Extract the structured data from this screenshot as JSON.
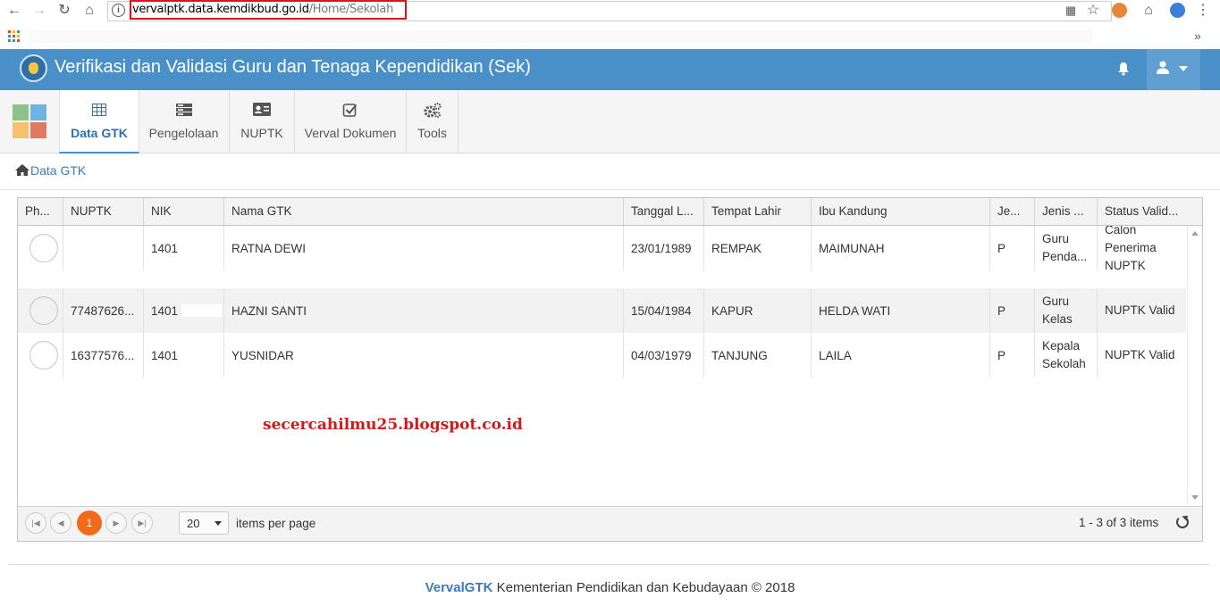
{
  "browser": {
    "url_host": "vervalptk.data.kemdikbud.go.id",
    "url_path": "/Home/Sekolah"
  },
  "header": {
    "title": "Verifikasi dan Validasi Guru dan Tenaga Kependidikan (Sek)"
  },
  "toolbar": {
    "items": [
      {
        "label": "Data GTK",
        "icon": "table-icon",
        "active": true
      },
      {
        "label": "Pengelolaan",
        "icon": "list-icon"
      },
      {
        "label": "NUPTK",
        "icon": "id-card-icon"
      },
      {
        "label": "Verval Dokumen",
        "icon": "check-square-icon"
      },
      {
        "label": "Tools",
        "icon": "cogs-icon"
      }
    ]
  },
  "breadcrumb": {
    "label": "Data GTK"
  },
  "table": {
    "columns": [
      "Ph...",
      "NUPTK",
      "NIK",
      "Nama GTK",
      "Tanggal L...",
      "Tempat Lahir",
      "Ibu Kandung",
      "Je...",
      "Jenis ...",
      "Status Valid..."
    ],
    "rows": [
      {
        "nuptk": "",
        "nik": "1401",
        "nama": "RATNA DEWI",
        "tgl": "23/01/1989",
        "tempat": "REMPAK",
        "ibu": "MAIMUNAH",
        "jk": "P",
        "jenis": "Guru Penda...",
        "status": "Calon Penerima NUPTK"
      },
      {
        "nuptk": "77487626...",
        "nik": "1401",
        "nama": "HAZNI SANTI",
        "tgl": "15/04/1984",
        "tempat": "KAPUR",
        "ibu": "HELDA WATI",
        "jk": "P",
        "jenis": "Guru Kelas",
        "status": "NUPTK Valid"
      },
      {
        "nuptk": "16377576...",
        "nik": "1401",
        "nama": "YUSNIDAR",
        "tgl": "04/03/1979",
        "tempat": "TANJUNG",
        "ibu": "LAILA",
        "jk": "P",
        "jenis": "Kepala Sekolah",
        "status": "NUPTK Valid"
      }
    ]
  },
  "watermark": "secercahilmu25.blogspot.co.id",
  "pager": {
    "current_page": "1",
    "page_size": "20",
    "per_page_label": "items per page",
    "count_label": "1 - 3 of 3 items"
  },
  "footer": {
    "brand": "VervalGTK",
    "text": " Kementerian Pendidikan dan Kebudayaan © 2018"
  },
  "colors": {
    "header": "#4a90c8",
    "accent": "#f26a1b",
    "highlight": "#e0131b"
  }
}
